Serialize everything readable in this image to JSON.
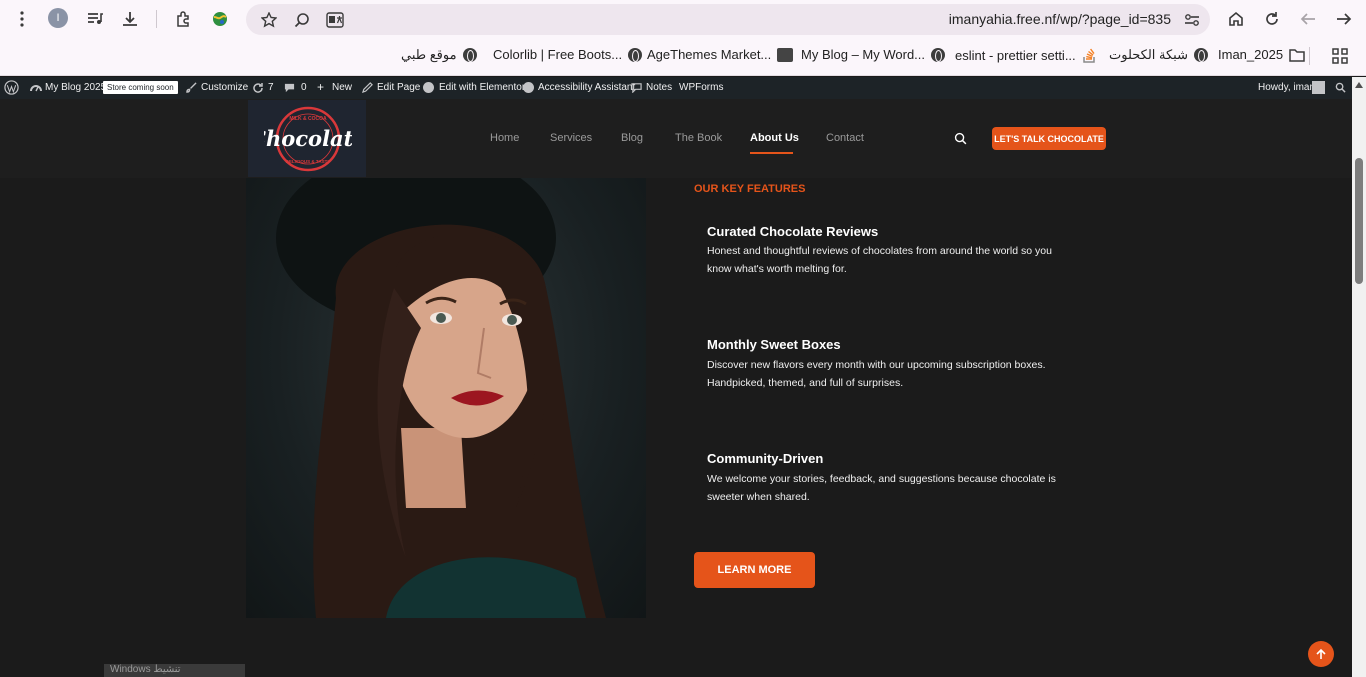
{
  "browser": {
    "url": "imanyahia.free.nf/wp/?page_id=835",
    "profile_initial": "I",
    "bookmarks": [
      {
        "label": "موقع طبي",
        "icon": "globe-icon"
      },
      {
        "label": "Colorlib | Free Boots...",
        "icon": "globe-icon"
      },
      {
        "label": "AgeThemes Market...",
        "icon": "agethemes-icon"
      },
      {
        "label": "My Blog – My Word...",
        "icon": "globe-icon"
      },
      {
        "label": "eslint - prettier setti...",
        "icon": "stackoverflow-icon"
      },
      {
        "label": "شبكة الكحلوت",
        "icon": "globe-icon"
      },
      {
        "label": "Iman_2025",
        "icon": "folder-icon"
      }
    ]
  },
  "adminbar": {
    "site_name": "My Blog 2025",
    "badge": "Store coming soon",
    "customize": "Customize",
    "updates": "7",
    "comments": "0",
    "new": "New",
    "edit_page": "Edit Page",
    "elementor": "Edit with Elementor",
    "accessibility": "Accessibility Assistant",
    "notes": "Notes",
    "wpforms": "WPForms",
    "howdy": "Howdy, iman"
  },
  "header": {
    "logo_text": "Chocolate",
    "logo_ring_top": "MILK & COCOA",
    "logo_ring_bottom": "DELICIOUS & TASTY",
    "nav": [
      {
        "label": "Home"
      },
      {
        "label": "Services"
      },
      {
        "label": "Blog"
      },
      {
        "label": "The Book"
      },
      {
        "label": "About Us",
        "active": true
      },
      {
        "label": "Contact"
      }
    ],
    "cta": "LET'S TALK CHOCOLATE"
  },
  "features": {
    "label": "OUR KEY FEATURES",
    "items": [
      {
        "title": "Curated Chocolate Reviews",
        "desc": "Honest and thoughtful reviews of chocolates from around the world  so you know what's worth melting for."
      },
      {
        "title": "Monthly Sweet Boxes",
        "desc": "Discover new flavors every month with our upcoming subscription boxes. Handpicked, themed, and full of surprises."
      },
      {
        "title": "Community-Driven",
        "desc": "We welcome your stories, feedback, and suggestions  because chocolate is sweeter when shared."
      }
    ],
    "button": "LEARN MORE"
  },
  "watermark": "Windows تنشيط",
  "colors": {
    "accent": "#e5541a",
    "background": "#1b1b1b",
    "adminbar": "#1d2327"
  }
}
